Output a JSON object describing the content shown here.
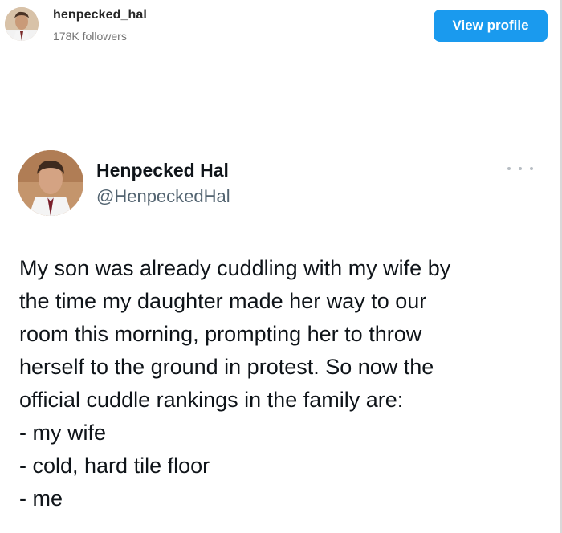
{
  "header": {
    "username": "henpecked_hal",
    "followers": "178K followers",
    "view_profile_label": "View profile",
    "avatar_icon": "profile-photo"
  },
  "tweet": {
    "display_name": "Henpecked Hal",
    "handle": "@HenpeckedHal",
    "more_icon": "more-options-icon",
    "lines": [
      "My son was already cuddling with my wife by",
      "the time my daughter made her way to our",
      "room this morning, prompting her to throw",
      "herself to the ground in protest. So now the",
      "official cuddle rankings in the family are:",
      "- my wife",
      "- cold, hard tile floor",
      "- me"
    ]
  },
  "colors": {
    "button_blue": "#1a9aee",
    "handle_gray": "#536471",
    "followers_gray": "#737373"
  }
}
